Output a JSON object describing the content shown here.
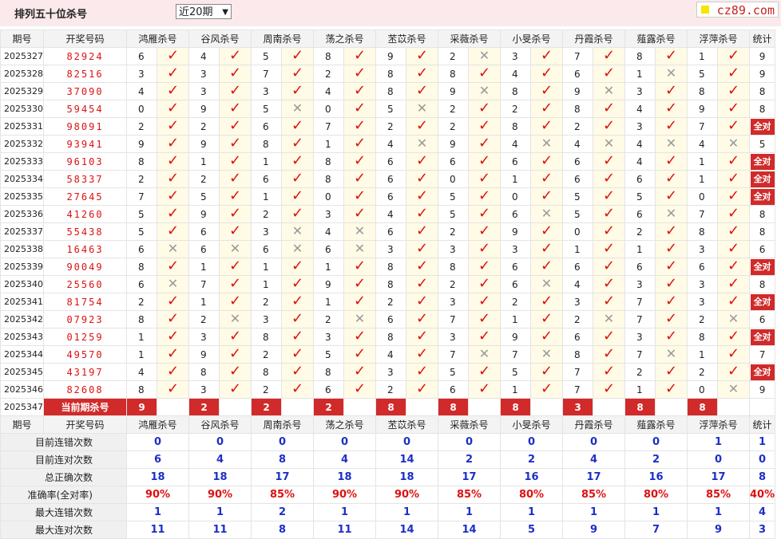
{
  "header": {
    "title": "排列五十位杀号",
    "select_value": "近20期",
    "logo_text": "cz89.com"
  },
  "columns": {
    "period": "期号",
    "code": "开奖号码",
    "stat": "统计",
    "killers": [
      "鸿雁杀号",
      "谷风杀号",
      "周南杀号",
      "荡之杀号",
      "苤苡杀号",
      "采薇杀号",
      "小旻杀号",
      "丹霞杀号",
      "薤露杀号",
      "浮萍杀号"
    ]
  },
  "marks": {
    "ok": "✓",
    "no": "✕"
  },
  "rows": [
    {
      "period": "2025327",
      "code": "82924",
      "kills": [
        [
          6,
          1
        ],
        [
          4,
          1
        ],
        [
          5,
          1
        ],
        [
          8,
          1
        ],
        [
          9,
          1
        ],
        [
          2,
          0
        ],
        [
          3,
          1
        ],
        [
          7,
          1
        ],
        [
          8,
          1
        ],
        [
          1,
          1
        ]
      ],
      "stat": "9"
    },
    {
      "period": "2025328",
      "code": "82516",
      "kills": [
        [
          3,
          1
        ],
        [
          3,
          1
        ],
        [
          7,
          1
        ],
        [
          2,
          1
        ],
        [
          8,
          1
        ],
        [
          8,
          1
        ],
        [
          4,
          1
        ],
        [
          6,
          1
        ],
        [
          1,
          0
        ],
        [
          5,
          1
        ]
      ],
      "stat": "9"
    },
    {
      "period": "2025329",
      "code": "37090",
      "kills": [
        [
          4,
          1
        ],
        [
          3,
          1
        ],
        [
          3,
          1
        ],
        [
          4,
          1
        ],
        [
          8,
          1
        ],
        [
          9,
          0
        ],
        [
          8,
          1
        ],
        [
          9,
          0
        ],
        [
          3,
          1
        ],
        [
          8,
          1
        ]
      ],
      "stat": "8"
    },
    {
      "period": "2025330",
      "code": "59454",
      "kills": [
        [
          0,
          1
        ],
        [
          9,
          1
        ],
        [
          5,
          0
        ],
        [
          0,
          1
        ],
        [
          5,
          0
        ],
        [
          2,
          1
        ],
        [
          2,
          1
        ],
        [
          8,
          1
        ],
        [
          4,
          1
        ],
        [
          9,
          1
        ]
      ],
      "stat": "8"
    },
    {
      "period": "2025331",
      "code": "98091",
      "kills": [
        [
          2,
          1
        ],
        [
          2,
          1
        ],
        [
          6,
          1
        ],
        [
          7,
          1
        ],
        [
          2,
          1
        ],
        [
          2,
          1
        ],
        [
          8,
          1
        ],
        [
          2,
          1
        ],
        [
          3,
          1
        ],
        [
          7,
          1
        ]
      ],
      "stat": "全对"
    },
    {
      "period": "2025332",
      "code": "93941",
      "kills": [
        [
          9,
          1
        ],
        [
          9,
          1
        ],
        [
          8,
          1
        ],
        [
          1,
          1
        ],
        [
          4,
          0
        ],
        [
          9,
          1
        ],
        [
          4,
          0
        ],
        [
          4,
          0
        ],
        [
          4,
          0
        ],
        [
          4,
          0
        ]
      ],
      "stat": "5"
    },
    {
      "period": "2025333",
      "code": "96103",
      "kills": [
        [
          8,
          1
        ],
        [
          1,
          1
        ],
        [
          1,
          1
        ],
        [
          8,
          1
        ],
        [
          6,
          1
        ],
        [
          6,
          1
        ],
        [
          6,
          1
        ],
        [
          6,
          1
        ],
        [
          4,
          1
        ],
        [
          1,
          1
        ]
      ],
      "stat": "全对"
    },
    {
      "period": "2025334",
      "code": "58337",
      "kills": [
        [
          2,
          1
        ],
        [
          2,
          1
        ],
        [
          6,
          1
        ],
        [
          8,
          1
        ],
        [
          6,
          1
        ],
        [
          0,
          1
        ],
        [
          1,
          1
        ],
        [
          6,
          1
        ],
        [
          6,
          1
        ],
        [
          1,
          1
        ]
      ],
      "stat": "全对"
    },
    {
      "period": "2025335",
      "code": "27645",
      "kills": [
        [
          7,
          1
        ],
        [
          5,
          1
        ],
        [
          1,
          1
        ],
        [
          0,
          1
        ],
        [
          6,
          1
        ],
        [
          5,
          1
        ],
        [
          0,
          1
        ],
        [
          5,
          1
        ],
        [
          5,
          1
        ],
        [
          0,
          1
        ]
      ],
      "stat": "全对"
    },
    {
      "period": "2025336",
      "code": "41260",
      "kills": [
        [
          5,
          1
        ],
        [
          9,
          1
        ],
        [
          2,
          1
        ],
        [
          3,
          1
        ],
        [
          4,
          1
        ],
        [
          5,
          1
        ],
        [
          6,
          0
        ],
        [
          5,
          1
        ],
        [
          6,
          0
        ],
        [
          7,
          1
        ]
      ],
      "stat": "8"
    },
    {
      "period": "2025337",
      "code": "55438",
      "kills": [
        [
          5,
          1
        ],
        [
          6,
          1
        ],
        [
          3,
          0
        ],
        [
          4,
          0
        ],
        [
          6,
          1
        ],
        [
          2,
          1
        ],
        [
          9,
          1
        ],
        [
          0,
          1
        ],
        [
          2,
          1
        ],
        [
          8,
          1
        ]
      ],
      "stat": "8"
    },
    {
      "period": "2025338",
      "code": "16463",
      "kills": [
        [
          6,
          0
        ],
        [
          6,
          0
        ],
        [
          6,
          0
        ],
        [
          6,
          0
        ],
        [
          3,
          1
        ],
        [
          3,
          1
        ],
        [
          3,
          1
        ],
        [
          1,
          1
        ],
        [
          1,
          1
        ],
        [
          3,
          1
        ]
      ],
      "stat": "6"
    },
    {
      "period": "2025339",
      "code": "90049",
      "kills": [
        [
          8,
          1
        ],
        [
          1,
          1
        ],
        [
          1,
          1
        ],
        [
          1,
          1
        ],
        [
          8,
          1
        ],
        [
          8,
          1
        ],
        [
          6,
          1
        ],
        [
          6,
          1
        ],
        [
          6,
          1
        ],
        [
          6,
          1
        ]
      ],
      "stat": "全对"
    },
    {
      "period": "2025340",
      "code": "25560",
      "kills": [
        [
          6,
          0
        ],
        [
          7,
          1
        ],
        [
          1,
          1
        ],
        [
          9,
          1
        ],
        [
          8,
          1
        ],
        [
          2,
          1
        ],
        [
          6,
          0
        ],
        [
          4,
          1
        ],
        [
          3,
          1
        ],
        [
          3,
          1
        ]
      ],
      "stat": "8"
    },
    {
      "period": "2025341",
      "code": "81754",
      "kills": [
        [
          2,
          1
        ],
        [
          1,
          1
        ],
        [
          2,
          1
        ],
        [
          1,
          1
        ],
        [
          2,
          1
        ],
        [
          3,
          1
        ],
        [
          2,
          1
        ],
        [
          3,
          1
        ],
        [
          7,
          1
        ],
        [
          3,
          1
        ]
      ],
      "stat": "全对"
    },
    {
      "period": "2025342",
      "code": "07923",
      "kills": [
        [
          8,
          1
        ],
        [
          2,
          0
        ],
        [
          3,
          1
        ],
        [
          2,
          0
        ],
        [
          6,
          1
        ],
        [
          7,
          1
        ],
        [
          1,
          1
        ],
        [
          2,
          0
        ],
        [
          7,
          1
        ],
        [
          2,
          0
        ]
      ],
      "stat": "6"
    },
    {
      "period": "2025343",
      "code": "01259",
      "kills": [
        [
          1,
          1
        ],
        [
          3,
          1
        ],
        [
          8,
          1
        ],
        [
          3,
          1
        ],
        [
          8,
          1
        ],
        [
          3,
          1
        ],
        [
          9,
          1
        ],
        [
          6,
          1
        ],
        [
          3,
          1
        ],
        [
          8,
          1
        ]
      ],
      "stat": "全对"
    },
    {
      "period": "2025344",
      "code": "49570",
      "kills": [
        [
          1,
          1
        ],
        [
          9,
          1
        ],
        [
          2,
          1
        ],
        [
          5,
          1
        ],
        [
          4,
          1
        ],
        [
          7,
          0
        ],
        [
          7,
          0
        ],
        [
          8,
          1
        ],
        [
          7,
          0
        ],
        [
          1,
          1
        ]
      ],
      "stat": "7"
    },
    {
      "period": "2025345",
      "code": "43197",
      "kills": [
        [
          4,
          1
        ],
        [
          8,
          1
        ],
        [
          8,
          1
        ],
        [
          8,
          1
        ],
        [
          3,
          1
        ],
        [
          5,
          1
        ],
        [
          5,
          1
        ],
        [
          7,
          1
        ],
        [
          2,
          1
        ],
        [
          2,
          1
        ]
      ],
      "stat": "全对"
    },
    {
      "period": "2025346",
      "code": "82608",
      "kills": [
        [
          8,
          1
        ],
        [
          3,
          1
        ],
        [
          2,
          1
        ],
        [
          6,
          1
        ],
        [
          2,
          1
        ],
        [
          6,
          1
        ],
        [
          1,
          1
        ],
        [
          7,
          1
        ],
        [
          1,
          1
        ],
        [
          0,
          0
        ]
      ],
      "stat": "9"
    }
  ],
  "current": {
    "period": "2025347",
    "label": "当前期杀号",
    "kills": [
      "9",
      "2",
      "2",
      "2",
      "8",
      "8",
      "8",
      "3",
      "8",
      "8"
    ]
  },
  "stats": [
    {
      "label": "目前连错次数",
      "values": [
        "0",
        "0",
        "0",
        "0",
        "0",
        "0",
        "0",
        "0",
        "0",
        "1",
        "1"
      ]
    },
    {
      "label": "目前连对次数",
      "values": [
        "6",
        "4",
        "8",
        "4",
        "14",
        "2",
        "2",
        "4",
        "2",
        "0",
        "0"
      ]
    },
    {
      "label": "总正确次数",
      "values": [
        "18",
        "18",
        "17",
        "18",
        "18",
        "17",
        "16",
        "17",
        "16",
        "17",
        "8"
      ]
    },
    {
      "label": "准确率(全对率)",
      "values": [
        "90%",
        "90%",
        "85%",
        "90%",
        "90%",
        "85%",
        "80%",
        "85%",
        "80%",
        "85%",
        "40%"
      ],
      "pct": true
    },
    {
      "label": "最大连错次数",
      "values": [
        "1",
        "1",
        "2",
        "1",
        "1",
        "1",
        "1",
        "1",
        "1",
        "1",
        "4"
      ]
    },
    {
      "label": "最大连对次数",
      "values": [
        "11",
        "11",
        "8",
        "11",
        "14",
        "14",
        "5",
        "9",
        "7",
        "9",
        "3"
      ]
    }
  ]
}
